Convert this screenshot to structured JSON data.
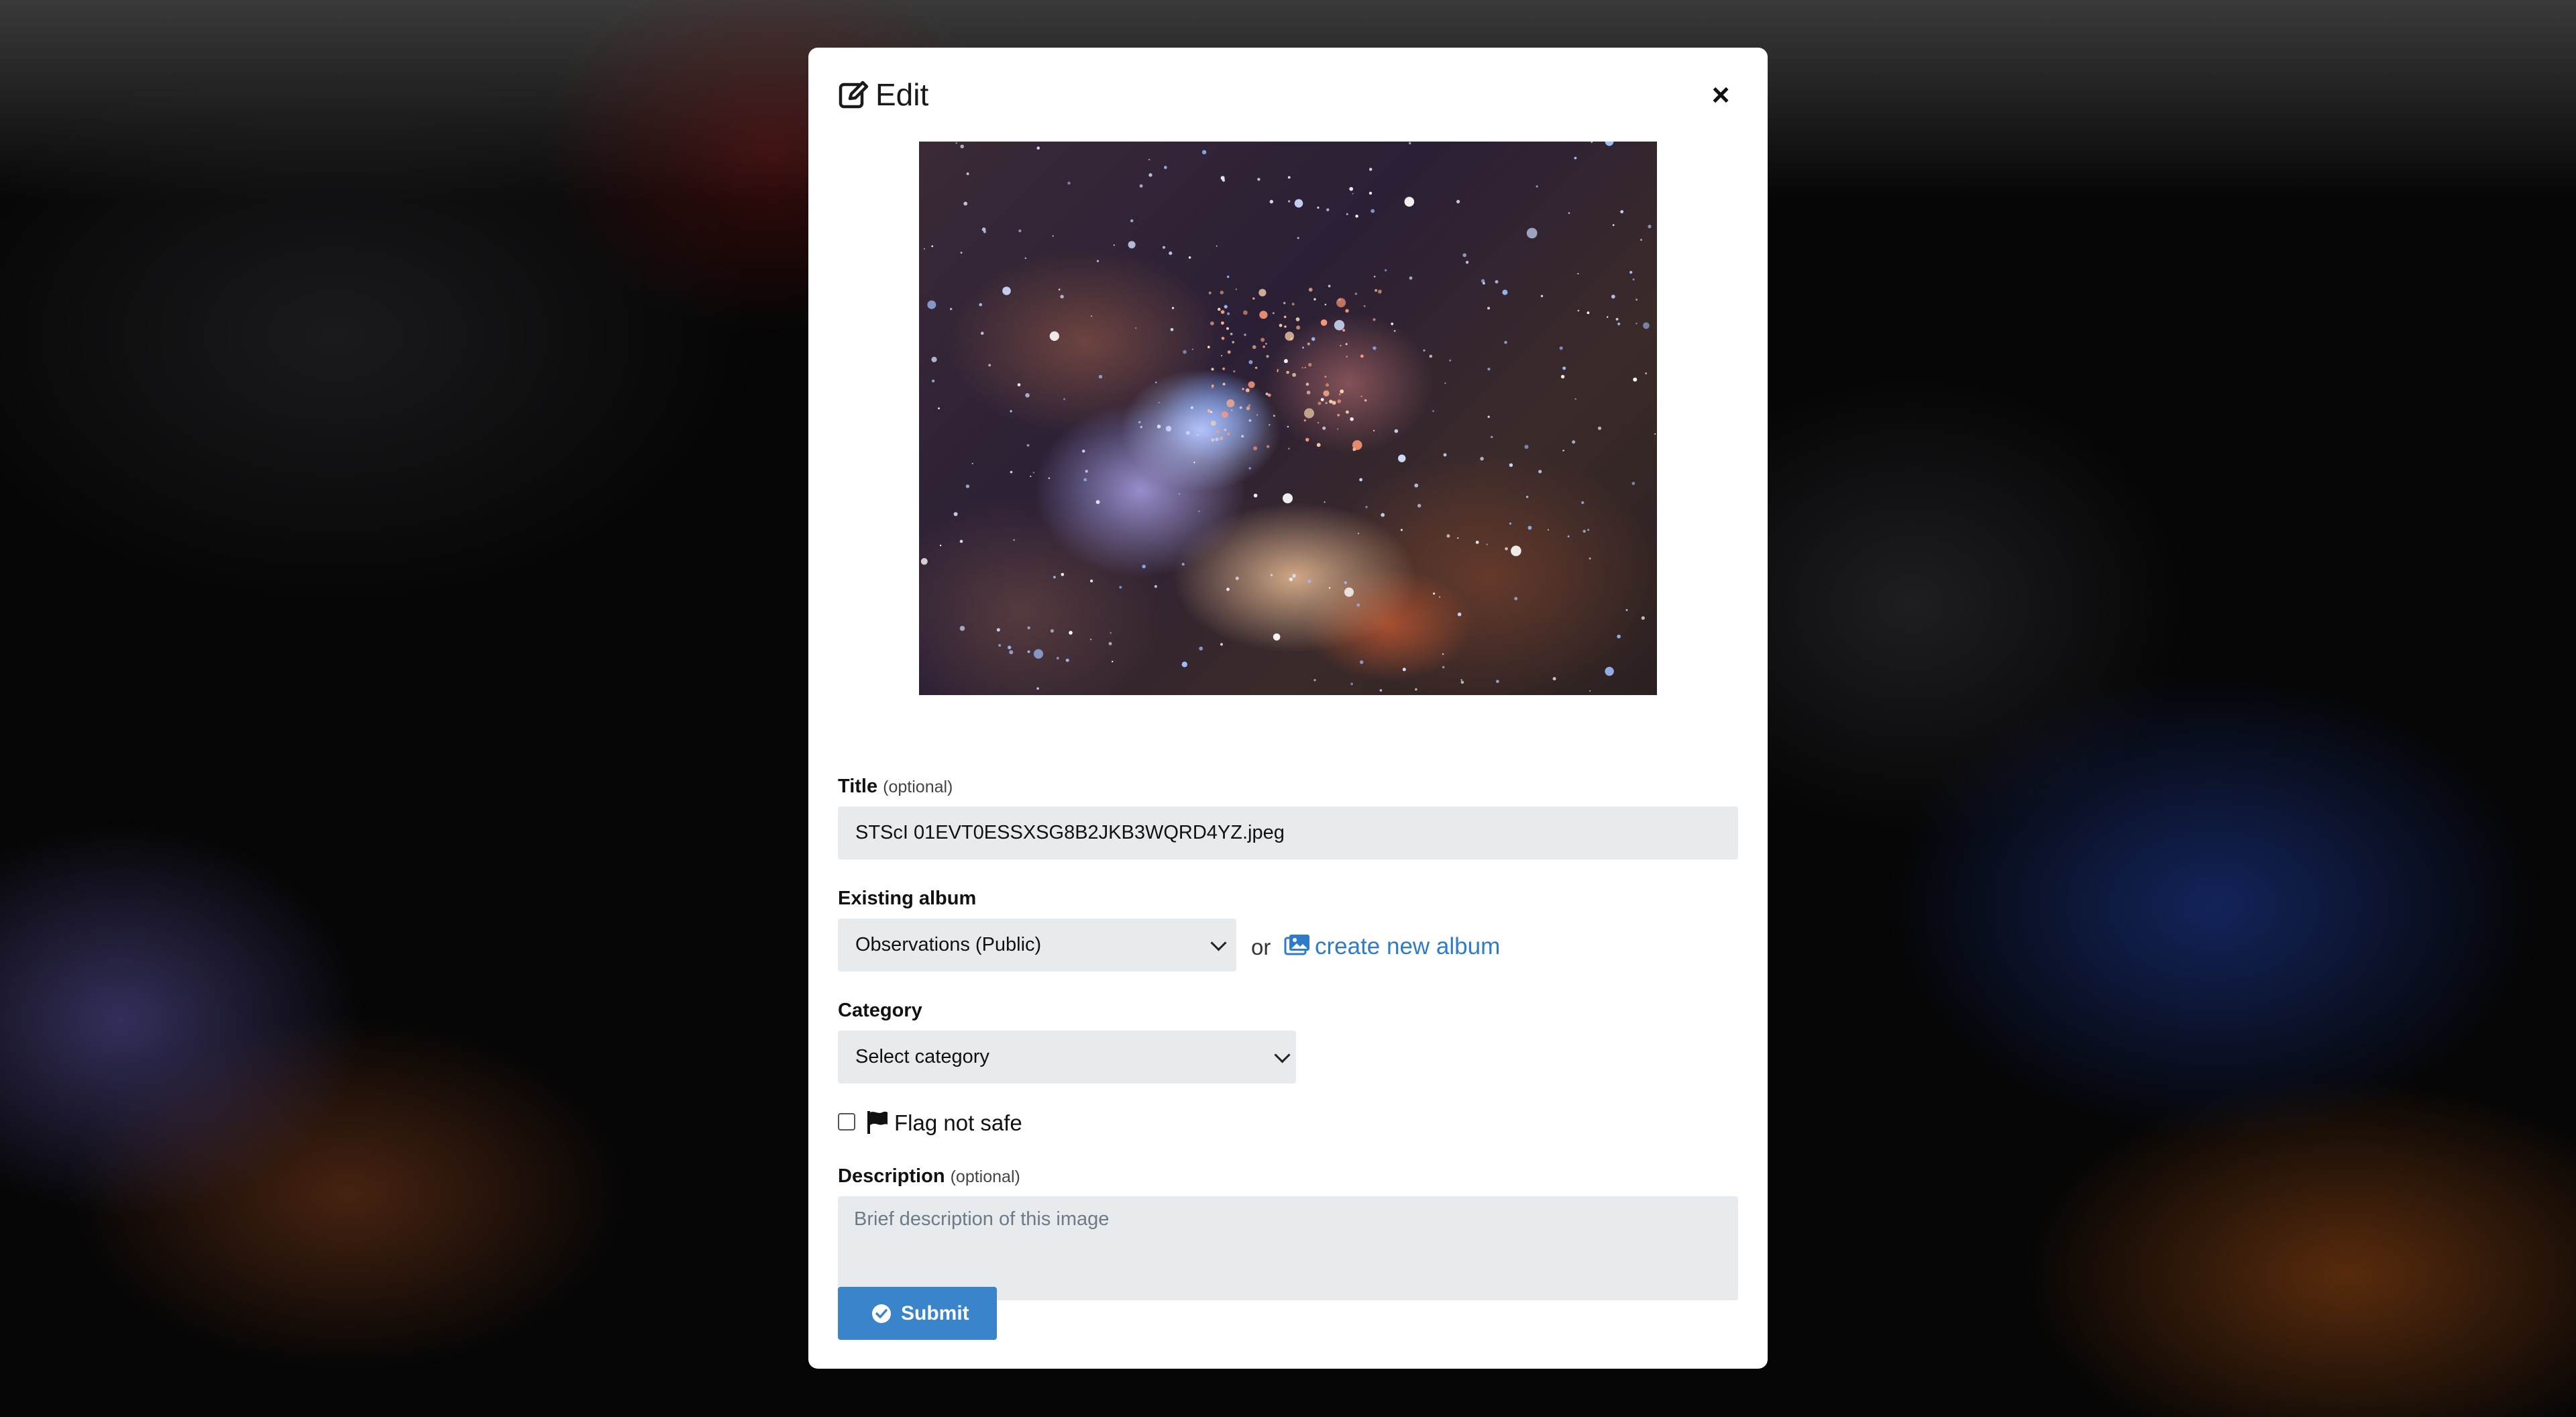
{
  "dialog": {
    "title": "Edit",
    "icon": "edit-icon",
    "close_label": "×"
  },
  "image_preview": {
    "description_icon": "nebula-image"
  },
  "title_field": {
    "label": "Title",
    "optional_label": "(optional)",
    "value": "STScI 01EVT0ESSXSG8B2JKB3WQRD4YZ.jpeg"
  },
  "album_field": {
    "label": "Existing album",
    "selected": "Observations (Public)",
    "or_text": "or",
    "create_link_label": "create new album",
    "create_link_icon": "image-album-icon"
  },
  "category_field": {
    "label": "Category",
    "selected": "Select category"
  },
  "flag": {
    "label": "Flag not safe",
    "icon": "flag-icon",
    "checked": false
  },
  "description_field": {
    "label": "Description",
    "optional_label": "(optional)",
    "placeholder": "Brief description of this image"
  },
  "submit": {
    "label": "Submit",
    "icon": "check-circle-icon"
  },
  "colors": {
    "accent": "#3a84cc",
    "link": "#2e7cc8",
    "input_bg": "#e8ebee"
  }
}
